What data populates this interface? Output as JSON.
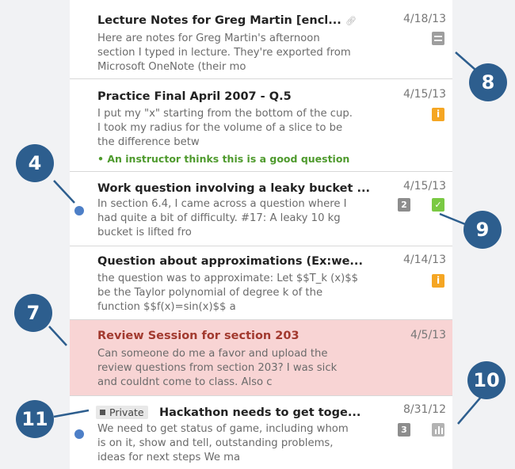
{
  "posts": [
    {
      "title": "Lecture Notes for Greg Martin [encl...",
      "snippet": "Here are notes for Greg Martin's afternoon section I typed in lecture. They're exported from Microsoft OneNote (their mo",
      "date": "4/18/13",
      "badge_icon": "note-icon",
      "has_attachment": true
    },
    {
      "title": "Practice Final April 2007 - Q.5",
      "snippet": "I put my \"x\" starting from the bottom of the cup. I took my radius for the volume of a slice to be the difference betw",
      "date": "4/15/13",
      "badge_text": "i",
      "endorsement": "An instructor thinks this is a good question"
    },
    {
      "title": "Work question involving a leaky bucket ...",
      "snippet": "In section 6.4, I came across a question where I had quite a bit of difficulty. #17: A leaky 10 kg bucket is lifted fro",
      "date": "4/15/13",
      "count_badge": "2",
      "badge_icon": "good-answer-icon",
      "unread": true
    },
    {
      "title": "Question about approximations (Ex:we...",
      "snippet": "the question was to approximate: Let $$T_k (x)$$ be the Taylor polynomial of degree k of the function $$f(x)=sin(x)$$ a",
      "date": "4/14/13",
      "badge_text": "i"
    },
    {
      "title": "Review Session for section 203",
      "snippet": "Can someone do me a favor and upload the review questions from section 203? I was sick and couldnt come to class. Also c",
      "date": "4/5/13",
      "pinned": true
    },
    {
      "private_label": "Private",
      "title": "Hackathon needs to get toge...",
      "snippet": "We need to get status of game, including whom is on it, show and tell, outstanding problems, ideas for next steps We ma",
      "date": "8/31/12",
      "count_badge": "3",
      "badge_icon": "poll-icon",
      "unread": true
    }
  ],
  "callouts": [
    "8",
    "4",
    "9",
    "7",
    "10",
    "11"
  ],
  "colors": {
    "callout": "#2d5e8e",
    "unread_dot": "#4d7fc7",
    "pinned_bg": "#f8d4d4",
    "pinned_title": "#a23a2f",
    "instructor_badge": "#f5a623",
    "good_badge": "#7ac943",
    "endorsement_text": "#4e9a2d"
  }
}
